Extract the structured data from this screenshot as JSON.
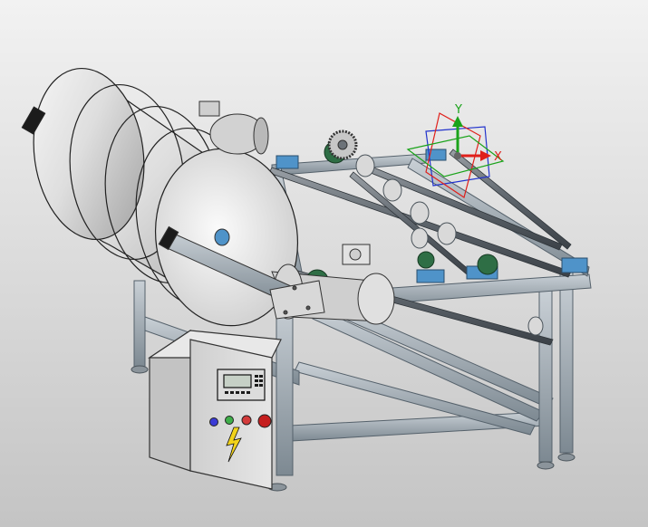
{
  "triad": {
    "x_label": "X",
    "y_label": "Y",
    "x_color": "#e0201b",
    "y_color": "#1aa31a",
    "z_color": "#2233cc"
  },
  "colors": {
    "frame": "#a9b3bb",
    "frame_dark": "#6f7b85",
    "drum": "#e3e3e3",
    "drum_shade": "#a7a7a7",
    "bearing_blue": "#4f93c9",
    "bearing_green": "#2e6e45",
    "panel": "#d7d7d7"
  },
  "control_panel": {
    "buttons": [
      {
        "name": "blue-button",
        "color": "#3b3bd6"
      },
      {
        "name": "green-button",
        "color": "#3fae4a"
      },
      {
        "name": "red-button",
        "color": "#d33b3b"
      },
      {
        "name": "emergency-stop-button",
        "color": "#c51e1e"
      }
    ]
  }
}
